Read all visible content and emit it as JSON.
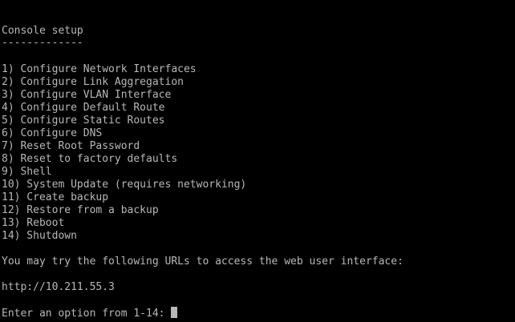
{
  "console": {
    "title": "Console setup",
    "underline": "-------------",
    "menu_items": [
      "1) Configure Network Interfaces",
      "2) Configure Link Aggregation",
      "3) Configure VLAN Interface",
      "4) Configure Default Route",
      "5) Configure Static Routes",
      "6) Configure DNS",
      "7) Reset Root Password",
      "8) Reset to factory defaults",
      "9) Shell",
      "10) System Update (requires networking)",
      "11) Create backup",
      "12) Restore from a backup",
      "13) Reboot",
      "14) Shutdown"
    ],
    "url_message": "You may try the following URLs to access the web user interface:",
    "url": "http://10.211.55.3",
    "prompt": "Enter an option from 1-14:",
    "input_value": ""
  },
  "colors": {
    "background": "#000000",
    "foreground": "#b8b8b8"
  }
}
